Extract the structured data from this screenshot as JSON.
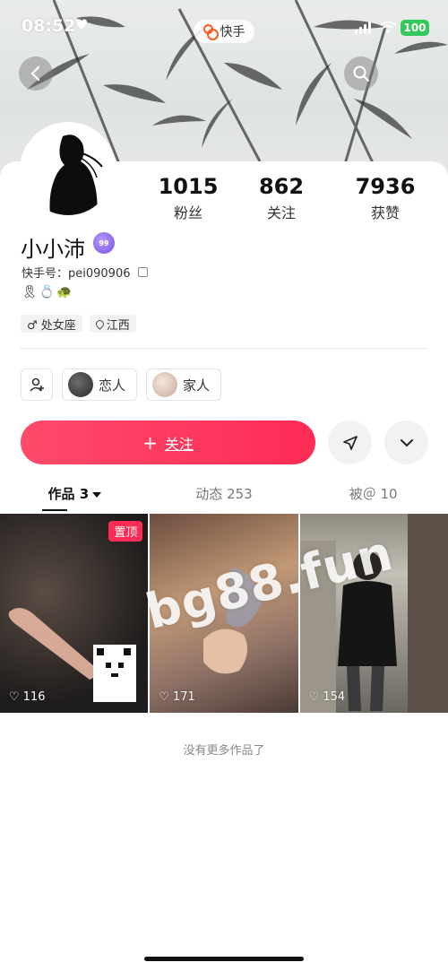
{
  "status_bar": {
    "time": "08:52",
    "battery": "100"
  },
  "app_pill": {
    "label": "快手"
  },
  "profile": {
    "nickname": "小小沛",
    "badge_text": "99",
    "kuaishou_id": "快手号：pei090906",
    "emojis": "🎗💍🐢",
    "tags": [
      {
        "icon": "male-icon",
        "label": "♂ 处女座"
      },
      {
        "icon": "location-icon",
        "label": "江西"
      }
    ]
  },
  "stats": [
    {
      "value": "1015",
      "label": "粉丝"
    },
    {
      "value": "862",
      "label": "关注"
    },
    {
      "value": "7936",
      "label": "获赞"
    }
  ],
  "relations": [
    {
      "label": "恋人"
    },
    {
      "label": "家人"
    }
  ],
  "follow_button": {
    "label": "关注"
  },
  "tabs": [
    {
      "label": "作品 3",
      "active": true
    },
    {
      "label": "动态 253",
      "active": false
    },
    {
      "label": "被＠ 10",
      "active": false
    }
  ],
  "posts": [
    {
      "pinned_label": "置顶",
      "likes": "116"
    },
    {
      "likes": "171"
    },
    {
      "likes": "154"
    }
  ],
  "watermark": "bg88.fun",
  "footer": {
    "no_more": "没有更多作品了"
  },
  "colors": {
    "accent": "#fe2c55",
    "battery": "#34c759",
    "badge": "#8a5cf0"
  }
}
